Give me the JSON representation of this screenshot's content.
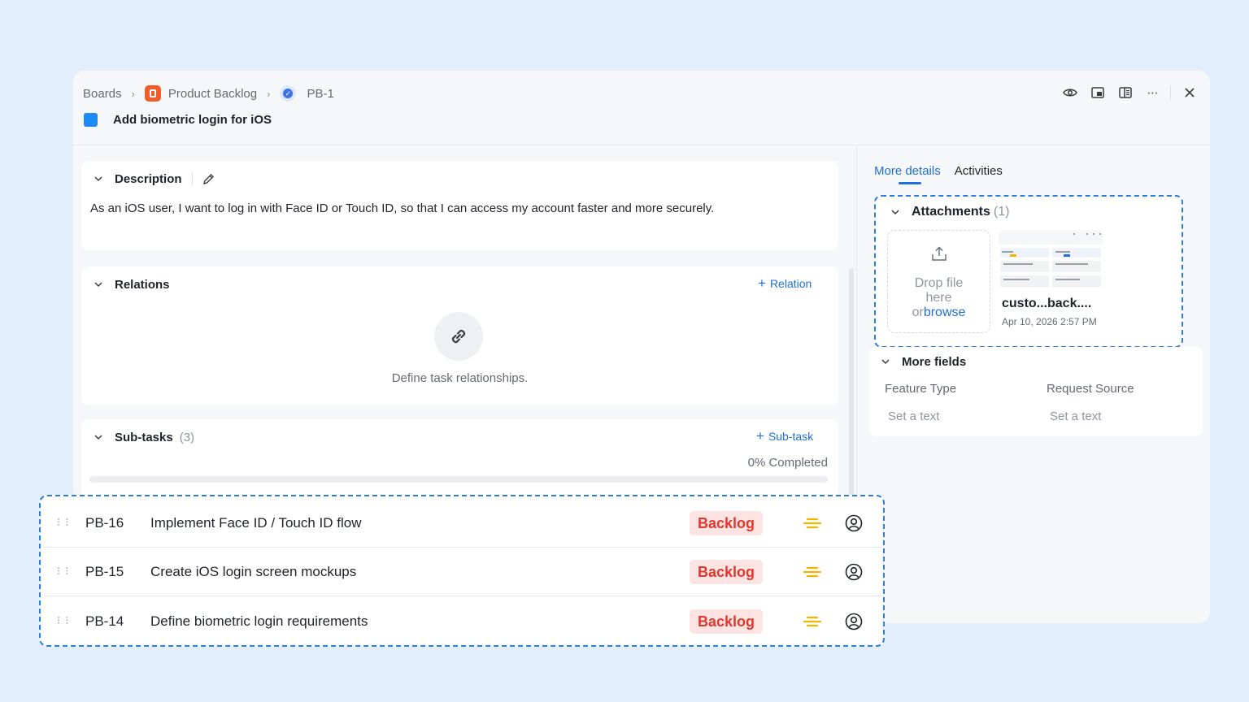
{
  "breadcrumb": {
    "boards": "Boards",
    "board": "Product Backlog",
    "task": "PB-1"
  },
  "task": {
    "title": "Add biometric login for iOS"
  },
  "description": {
    "heading": "Description",
    "text": "As an iOS user, I want to log in with Face ID or Touch ID, so that I can access my account faster and more securely."
  },
  "relations": {
    "heading": "Relations",
    "add_label": "Relation",
    "empty_text": "Define task relationships."
  },
  "subtasks": {
    "heading": "Sub-tasks",
    "count": "(3)",
    "add_label": "Sub-task",
    "progress_text": "0% Completed",
    "progress_fraction": 0,
    "items": [
      {
        "id": "PB-16",
        "title": "Implement Face ID / Touch ID flow",
        "status": "Backlog"
      },
      {
        "id": "PB-15",
        "title": "Create iOS login screen mockups",
        "status": "Backlog"
      },
      {
        "id": "PB-14",
        "title": "Define biometric login requirements",
        "status": "Backlog"
      }
    ]
  },
  "tabs": {
    "more_details": "More details",
    "activities": "Activities"
  },
  "attachments": {
    "heading": "Attachments",
    "count": "(1)",
    "drop_line1": "Drop file",
    "drop_line2": "here",
    "drop_or": "or",
    "drop_browse": "browse",
    "file_name": "custo...back....",
    "file_date": "Apr 10, 2026 2:57 PM"
  },
  "more_fields": {
    "heading": "More fields",
    "feature_type_label": "Feature Type",
    "feature_type_value": "Set a text",
    "request_source_label": "Request Source",
    "request_source_value": "Set a text"
  },
  "colors": {
    "accent": "#1e6fd9",
    "status_backlog_bg": "#fde4e2",
    "status_backlog_text": "#e0382e",
    "priority": "#f5b400",
    "board_icon": "#f25c2a"
  }
}
